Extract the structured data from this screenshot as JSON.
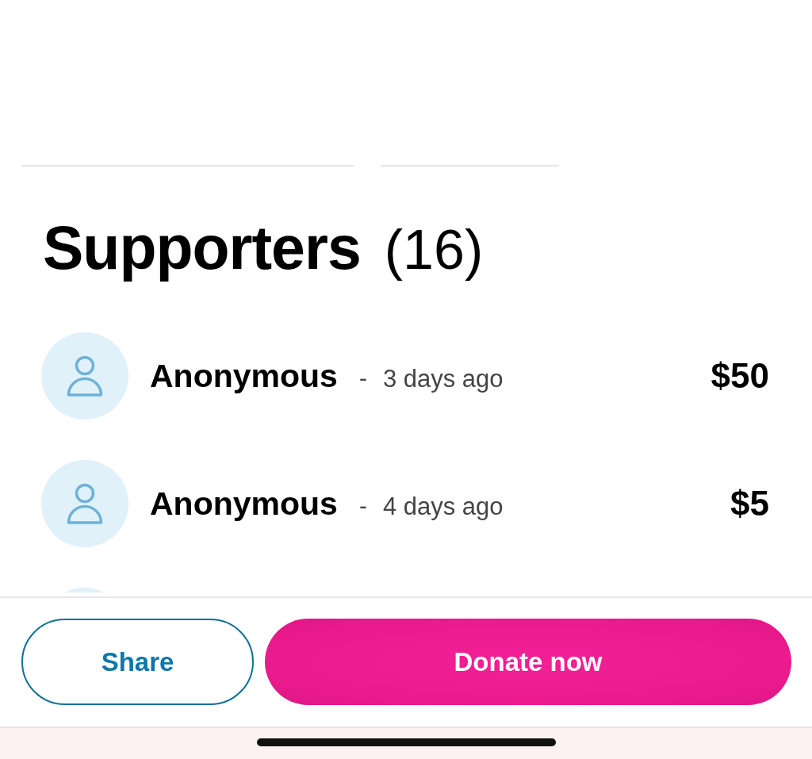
{
  "supporters": {
    "title": "Supporters",
    "count": "(16)",
    "items": [
      {
        "name": "Anonymous",
        "separator": "-",
        "time": "3 days ago",
        "amount": "$50"
      },
      {
        "name": "Anonymous",
        "separator": "-",
        "time": "4 days ago",
        "amount": "$5"
      }
    ]
  },
  "actions": [
    {
      "kind": "secondary",
      "label": "Share"
    },
    {
      "kind": "primary",
      "label": "Donate now"
    }
  ]
}
